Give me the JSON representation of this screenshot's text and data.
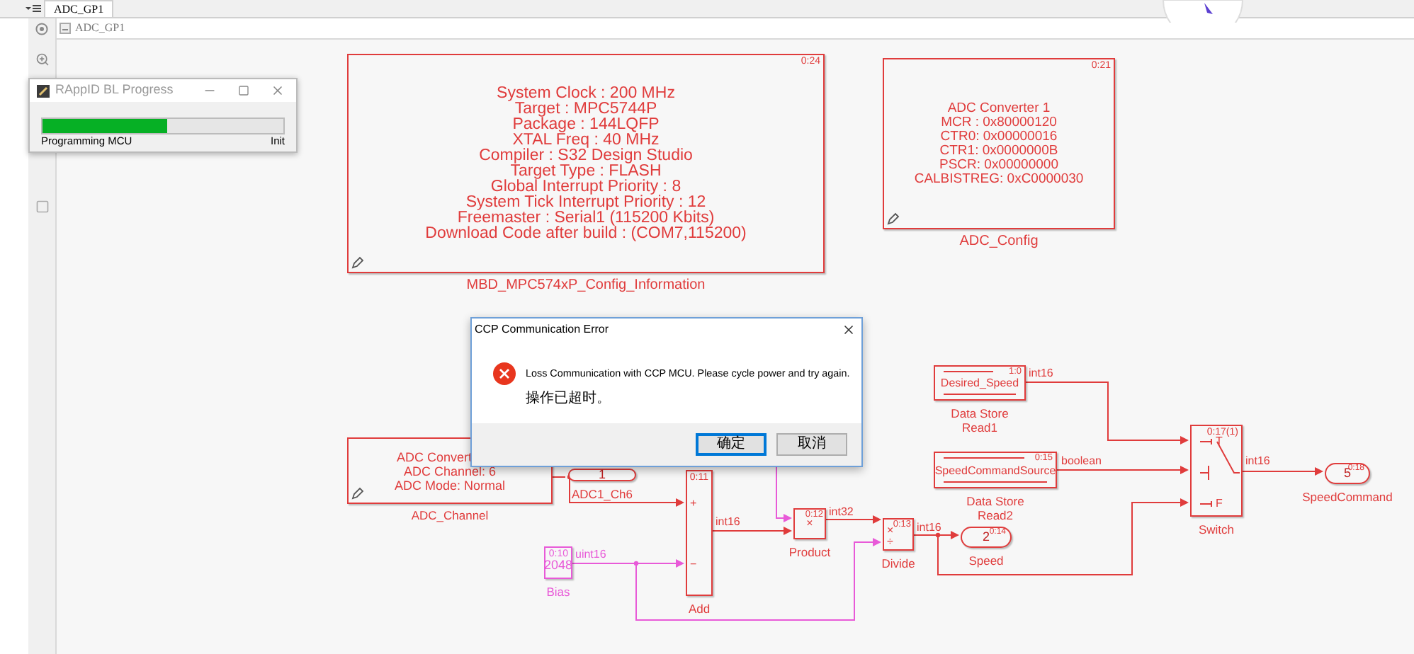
{
  "tab": {
    "label": "ADC_GP1",
    "selected": true
  },
  "address_bar": {
    "path": "ADC_GP1"
  },
  "progress_window": {
    "title": "RAppID BL Progress",
    "level": 0.52,
    "status": "Programming MCU",
    "stage": "Init"
  },
  "blocks": [
    {
      "kind": "annotation",
      "color": "#e03c3c",
      "time": "0:24",
      "lines": [
        "System Clock : 200 MHz",
        "Target : MPC5744P",
        "Package : 144LQFP",
        "XTAL Freq : 40 MHz",
        "Compiler : S32 Design Studio",
        "Target Type : FLASH",
        "Global Interrupt Priority : 8",
        "System Tick Interrupt Priority : 12",
        "Freemaster : Serial1 (115200 Kbits)",
        "Download Code after build : (COM7,115200)"
      ],
      "label_lines": [
        "MBD_MPC574xP_Config_Information"
      ]
    },
    {
      "kind": "annotation",
      "color": "#e03c3c",
      "time": "0:21",
      "lines": [
        "ADC Converter 1",
        "MCR : 0x80000120",
        "CTR0: 0x00000016",
        "CTR1: 0x0000000B",
        "PSCR: 0x00000000",
        "CALBISTREG: 0xC0000030"
      ],
      "label_lines": [
        "ADC_Config"
      ]
    },
    {
      "kind": "data_store",
      "color": "#e03c3c",
      "name": "Desired_Speed",
      "time": "1:0",
      "label_lines": [
        "Data Store",
        "Read1"
      ]
    },
    {
      "kind": "annotation",
      "color": "#e03c3c",
      "lines": [
        "ADC Convert",
        "ADC Channel: 6",
        "ADC Mode: Normal"
      ],
      "label_lines": [
        "ADC_Channel"
      ]
    },
    {
      "kind": "outport",
      "color": "#e03c3c",
      "number": "1",
      "label_lines": [
        "ADC1_Ch6"
      ]
    },
    {
      "kind": "sum",
      "color": "#e03c3c",
      "time": "0:11",
      "ports": [
        "+",
        "−"
      ],
      "label_lines": [
        "Add"
      ]
    },
    {
      "kind": "data_store",
      "color": "#e03c3c",
      "name": "SpeedCommandSource",
      "time": "0:15",
      "label_lines": [
        "Data Store",
        "Read2"
      ]
    },
    {
      "kind": "switch",
      "color": "#e03c3c",
      "time": "0:17(1)",
      "ports": [
        "T",
        "F"
      ],
      "label_lines": [
        "Switch"
      ]
    },
    {
      "kind": "outport",
      "color": "#e03c3c",
      "number": "5",
      "time": "0:18",
      "label_lines": [
        "SpeedCommand"
      ]
    },
    {
      "kind": "product",
      "color": "#e03c3c",
      "time": "0:12",
      "symbols": [
        "×"
      ],
      "label_lines": [
        "Product"
      ]
    },
    {
      "kind": "product",
      "color": "#e03c3c",
      "time": "0:13",
      "symbols": [
        "×",
        "÷"
      ],
      "label_lines": [
        "Divide"
      ]
    },
    {
      "kind": "outport",
      "color": "#e03c3c",
      "number": "2",
      "time": "0:14",
      "label_lines": [
        "Speed"
      ]
    },
    {
      "kind": "constant",
      "color": "#e85ad8",
      "value": "2048",
      "time": "0:10",
      "label_lines": [
        "Bias"
      ]
    }
  ],
  "signal_labels": [
    {
      "text": "int16",
      "color": "#e03c3c"
    },
    {
      "text": "boolean",
      "color": "#e03c3c"
    },
    {
      "text": "int16",
      "color": "#e03c3c"
    },
    {
      "text": "int32",
      "color": "#e03c3c"
    },
    {
      "text": "int16",
      "color": "#e03c3c"
    },
    {
      "text": "int16",
      "color": "#e03c3c"
    },
    {
      "text": "uint16",
      "color": "#e85ad8"
    }
  ],
  "error_dialog": {
    "title": "CCP Communication Error",
    "message": "Loss Communication with CCP MCU. Please cycle power and try again.",
    "detail": "操作已超时。",
    "buttons": [
      {
        "label": "确定",
        "selected": true
      },
      {
        "label": "取消",
        "selected": false
      }
    ]
  }
}
